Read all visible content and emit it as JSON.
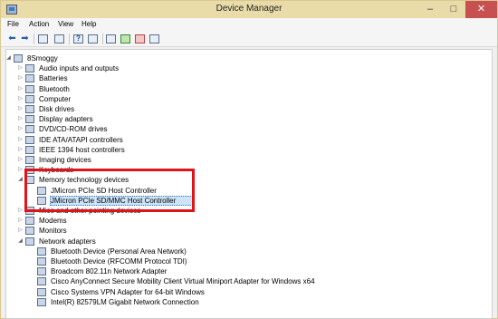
{
  "window": {
    "title": "Device Manager",
    "minimize_glyph": "–",
    "maximize_glyph": "□",
    "close_glyph": "✕"
  },
  "menu": [
    "File",
    "Action",
    "View",
    "Help"
  ],
  "toolbar": {
    "back_glyph": "⬅",
    "forward_glyph": "➡",
    "help_glyph": "?"
  },
  "tree": {
    "root": "8Smoggy",
    "categories": [
      "Audio inputs and outputs",
      "Batteries",
      "Bluetooth",
      "Computer",
      "Disk drives",
      "Display adapters",
      "DVD/CD-ROM drives",
      "IDE ATA/ATAPI controllers",
      "IEEE 1394 host controllers",
      "Imaging devices",
      "Keyboards",
      "Memory technology devices",
      "JMicron PCIe SD Host Controller",
      "JMicron PCIe SD/MMC Host Controller",
      "Mice and other pointing devices",
      "Modems",
      "Monitors",
      "Network adapters",
      "Bluetooth Device (Personal Area Network)",
      "Bluetooth Device (RFCOMM Protocol TDI)",
      "Broadcom 802.11n Network Adapter",
      "Cisco AnyConnect Secure Mobility Client Virtual Miniport Adapter for Windows x64",
      "Cisco Systems VPN Adapter for 64-bit Windows",
      "Intel(R) 82579LM Gigabit Network Connection"
    ],
    "expanded_glyph": "◢",
    "collapsed_glyph": "▷"
  },
  "colors": {
    "title_bar": "#e9dca9",
    "close_button": "#c75050",
    "selection": "#cce4f7",
    "annotation_box": "#e0121a"
  }
}
